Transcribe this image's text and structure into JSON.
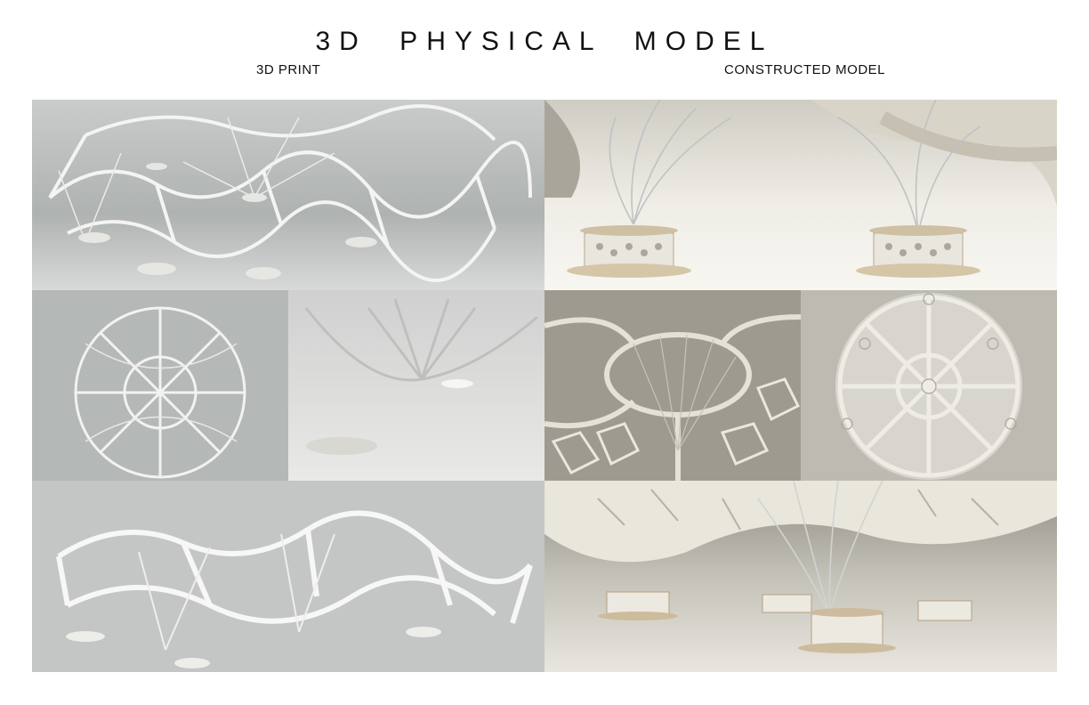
{
  "page": {
    "title": "3D   PHYSICAL   MODEL",
    "left_heading": "3D  PRINT",
    "right_heading": "CONSTRUCTED  MODEL"
  },
  "photos": {
    "print_top": "3d-print-wide-view",
    "print_mid_left": "3d-print-top-view",
    "print_mid_right": "3d-print-closeup",
    "print_bottom": "3d-print-side-view",
    "constructed_top": "constructed-columns-view",
    "constructed_mid_left": "constructed-underside-view",
    "constructed_mid_right": "constructed-top-view",
    "constructed_bottom": "constructed-canopy-view"
  },
  "colors": {
    "background": "#ffffff",
    "print_grey": "#b9bcbb",
    "model_cream": "#ecebe4"
  }
}
